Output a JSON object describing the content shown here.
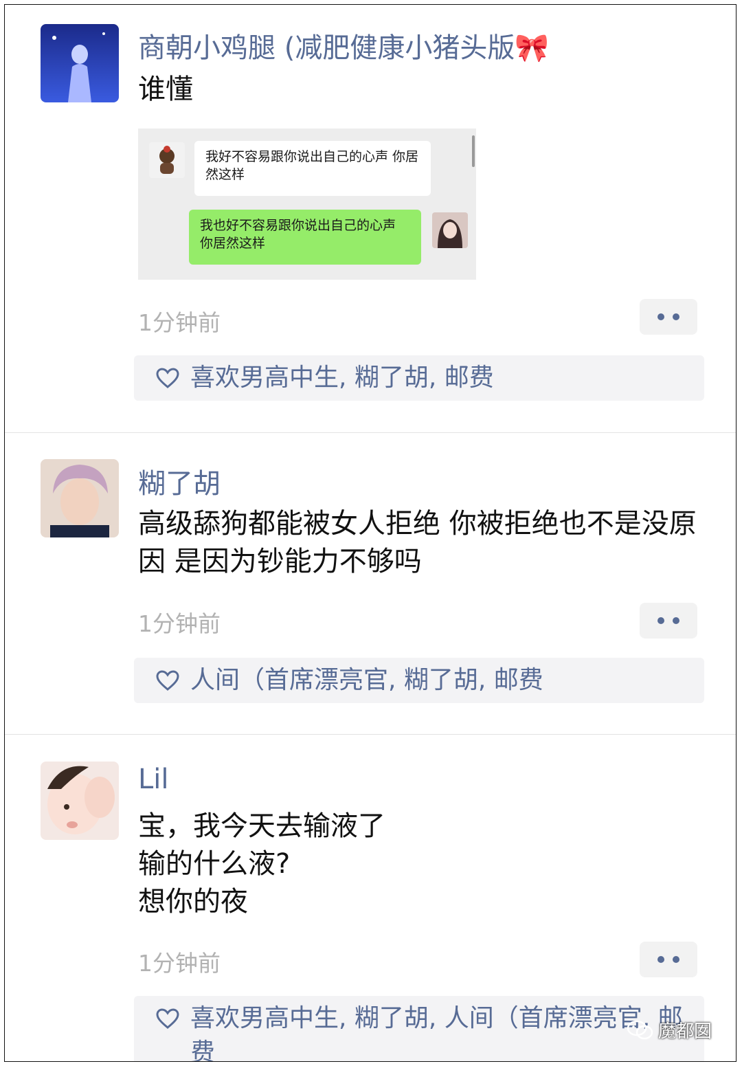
{
  "posts": [
    {
      "author": "商朝小鸡腿 (减肥健康小猪头版🎀",
      "text": "谁懂",
      "image": {
        "left_message": "我好不容易跟你说出自己的心声 你居然这样",
        "right_message": "我也好不容易跟你说出自己的心声 你居然这样"
      },
      "time": "1分钟前",
      "likes": "喜欢男高中生, 糊了胡, 邮费"
    },
    {
      "author": "糊了胡",
      "text": "高级舔狗都能被女人拒绝 你被拒绝也不是没原因 是因为钞能力不够吗",
      "time": "1分钟前",
      "likes": "人间（首席漂亮官, 糊了胡, 邮费"
    },
    {
      "author": "Lil",
      "text": "宝，我今天去输液了\n输的什么液?\n想你的夜",
      "time": "1分钟前",
      "likes": "喜欢男高中生, 糊了胡, 人间（首席漂亮官, 邮费"
    }
  ],
  "watermark": "魔都囡",
  "colors": {
    "name": "#576b95",
    "time": "#b2b2b2",
    "likes_bg": "#f3f3f5",
    "chat_green": "#95ec69"
  },
  "icons": [
    "heart-icon",
    "more-dots-icon",
    "wechat-icon"
  ]
}
